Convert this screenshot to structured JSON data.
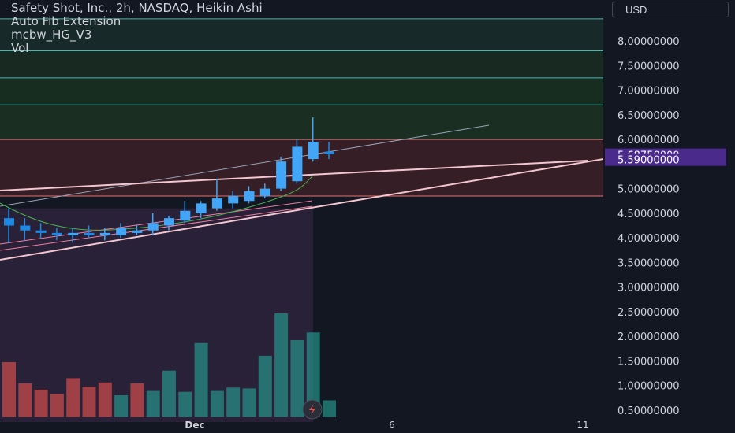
{
  "legend": {
    "title": "Safety Shot, Inc., 2h, NASDAQ, Heikin Ashi",
    "indicator_1": "Auto Fib Extension",
    "indicator_2": "mcbw_HG_V3",
    "indicator_3": "Vol"
  },
  "currency": "USD",
  "colors": {
    "background": "#131722",
    "up_candle": "#42a5f5",
    "volume_up": "#26a69a",
    "volume_down": "#ef5350",
    "price_tag": "#4a2a8a",
    "fib_line": "#4db6ac"
  },
  "chart_data": {
    "type": "candlestick",
    "y_axis": {
      "range": [
        0.3,
        8.35
      ],
      "ticks": [
        "8.00000000",
        "7.50000000",
        "7.00000000",
        "6.50000000",
        "6.00000000",
        "5.00000000",
        "4.50000000",
        "4.00000000",
        "3.50000000",
        "3.00000000",
        "2.50000000",
        "2.00000000",
        "1.50000000",
        "1.00000000",
        "0.50000000"
      ],
      "tick_values": [
        8.0,
        7.5,
        7.0,
        6.5,
        6.0,
        5.0,
        4.5,
        4.0,
        3.5,
        3.0,
        2.5,
        2.0,
        1.5,
        1.0,
        0.5
      ]
    },
    "x_axis": {
      "labels": [
        "Dec",
        "6",
        "11"
      ]
    },
    "price_tags": [
      {
        "value": 5.6875,
        "text": "5.68750000"
      },
      {
        "value": 5.59,
        "text": "5.59000000"
      }
    ],
    "fib_levels": [
      8.45,
      7.8,
      7.25,
      6.7,
      6.0,
      4.85
    ],
    "candles": [
      {
        "o": 4.4,
        "h": 4.6,
        "l": 3.9,
        "c": 4.25
      },
      {
        "o": 4.25,
        "h": 4.4,
        "l": 3.95,
        "c": 4.15
      },
      {
        "o": 4.15,
        "h": 4.3,
        "l": 4.0,
        "c": 4.1
      },
      {
        "o": 4.1,
        "h": 4.2,
        "l": 3.95,
        "c": 4.05
      },
      {
        "o": 4.05,
        "h": 4.2,
        "l": 3.9,
        "c": 4.1
      },
      {
        "o": 4.1,
        "h": 4.25,
        "l": 4.0,
        "c": 4.05
      },
      {
        "o": 4.05,
        "h": 4.2,
        "l": 3.95,
        "c": 4.1
      },
      {
        "o": 4.05,
        "h": 4.3,
        "l": 4.0,
        "c": 4.2
      },
      {
        "o": 4.1,
        "h": 4.25,
        "l": 4.05,
        "c": 4.15
      },
      {
        "o": 4.15,
        "h": 4.5,
        "l": 4.05,
        "c": 4.3
      },
      {
        "o": 4.25,
        "h": 4.45,
        "l": 4.15,
        "c": 4.4
      },
      {
        "o": 4.35,
        "h": 4.75,
        "l": 4.3,
        "c": 4.55
      },
      {
        "o": 4.5,
        "h": 4.75,
        "l": 4.4,
        "c": 4.7
      },
      {
        "o": 4.6,
        "h": 5.2,
        "l": 4.55,
        "c": 4.8
      },
      {
        "o": 4.7,
        "h": 4.95,
        "l": 4.6,
        "c": 4.85
      },
      {
        "o": 4.75,
        "h": 5.05,
        "l": 4.7,
        "c": 4.95
      },
      {
        "o": 4.85,
        "h": 5.1,
        "l": 4.8,
        "c": 5.0
      },
      {
        "o": 5.0,
        "h": 5.65,
        "l": 4.95,
        "c": 5.55
      },
      {
        "o": 5.15,
        "h": 6.0,
        "l": 5.1,
        "c": 5.85
      },
      {
        "o": 5.6,
        "h": 6.45,
        "l": 5.55,
        "c": 5.95
      },
      {
        "o": 5.75,
        "h": 5.95,
        "l": 5.6,
        "c": 5.7
      }
    ],
    "volume": [
      1.3,
      0.8,
      0.65,
      0.55,
      0.92,
      0.72,
      0.82,
      0.52,
      0.8,
      0.62,
      1.1,
      0.6,
      1.75,
      0.62,
      0.7,
      0.68,
      1.45,
      2.45,
      1.82,
      2.0,
      0.4
    ],
    "volume_up": [
      false,
      false,
      false,
      false,
      false,
      false,
      false,
      true,
      false,
      true,
      true,
      true,
      true,
      true,
      true,
      true,
      true,
      true,
      true,
      true,
      true
    ]
  }
}
